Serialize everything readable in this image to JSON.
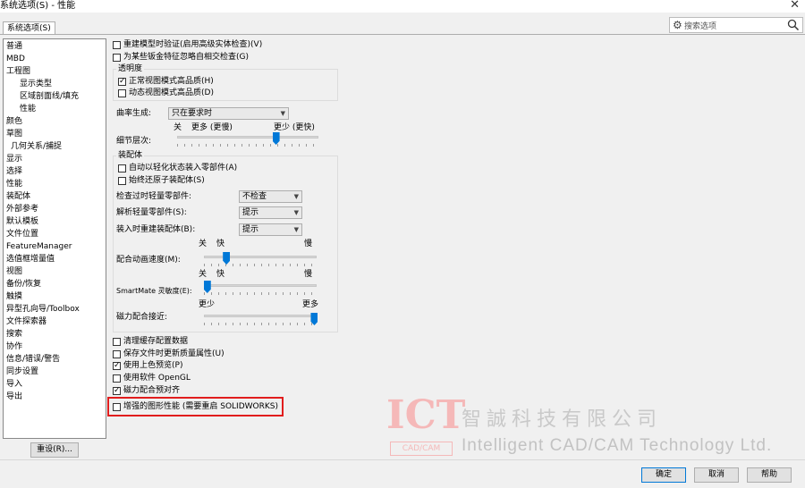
{
  "window": {
    "title": "系统选项(S) - 性能"
  },
  "tab": {
    "label": "系统选项(S)"
  },
  "search": {
    "placeholder": "搜索选项",
    "gear": "gear-icon",
    "mag": "search-icon"
  },
  "nav": {
    "items": [
      {
        "label": "普通",
        "level": 1
      },
      {
        "label": "MBD",
        "level": 1
      },
      {
        "label": "工程图",
        "level": 1
      },
      {
        "label": "显示类型",
        "level": 3
      },
      {
        "label": "区域剖面线/填充",
        "level": 3
      },
      {
        "label": "性能",
        "level": 3
      },
      {
        "label": "颜色",
        "level": 1
      },
      {
        "label": "草图",
        "level": 1
      },
      {
        "label": "几何关系/捕捉",
        "level": 2
      },
      {
        "label": "显示",
        "level": 1
      },
      {
        "label": "选择",
        "level": 1
      },
      {
        "label": "性能",
        "level": 1
      },
      {
        "label": "装配体",
        "level": 1
      },
      {
        "label": "外部参考",
        "level": 1
      },
      {
        "label": "默认模板",
        "level": 1
      },
      {
        "label": "文件位置",
        "level": 1
      },
      {
        "label": "FeatureManager",
        "level": 1
      },
      {
        "label": "选值框增量值",
        "level": 1
      },
      {
        "label": "视图",
        "level": 1
      },
      {
        "label": "备份/恢复",
        "level": 1
      },
      {
        "label": "触摸",
        "level": 1
      },
      {
        "label": "异型孔向导/Toolbox",
        "level": 1
      },
      {
        "label": "文件探索器",
        "level": 1
      },
      {
        "label": "搜索",
        "level": 1
      },
      {
        "label": "协作",
        "level": 1
      },
      {
        "label": "信息/错误/警告",
        "level": 1
      },
      {
        "label": "同步设置",
        "level": 1
      },
      {
        "label": "导入",
        "level": 1
      },
      {
        "label": "导出",
        "level": 1
      }
    ],
    "reset_label": "重设(R)..."
  },
  "options": {
    "rebuild_verify": {
      "label": "重建模型时验证(启用高级实体检查)(V)",
      "checked": false
    },
    "ignore_sheetmetal": {
      "label": "为某些钣金特征忽略自相交检查(G)",
      "checked": false
    },
    "transparency": {
      "title": "透明度",
      "normal_hq": {
        "label": "正常视图模式高品质(H)",
        "checked": true
      },
      "dynamic_hq": {
        "label": "动态视图模式高品质(D)",
        "checked": false
      }
    },
    "curvature": {
      "label": "曲率生成:",
      "value": "只在要求时"
    },
    "lod": {
      "label": "细节层次:",
      "off": "关",
      "more": "更多 (更慢)",
      "less": "更少 (更快)",
      "level": 0.7
    },
    "assembly": {
      "title": "装配体",
      "auto_lightweight": {
        "label": "自动以轻化状态装入零部件(A)",
        "checked": false
      },
      "always_resolve": {
        "label": "始终还原子装配体(S)",
        "checked": false
      },
      "check_outdated": {
        "label": "检查过时轻量零部件:",
        "value": "不检查"
      },
      "resolve_lightweight": {
        "label": "解析轻量零部件(S):",
        "value": "提示"
      },
      "rebuild_on_load": {
        "label": "装入时重建装配体(B):",
        "value": "提示"
      },
      "mate_anim": {
        "label": "配合动画速度(M):",
        "off": "关",
        "fast": "快",
        "slow": "慢",
        "level": 0.2
      },
      "smartmate": {
        "label": "SmartMate 灵敏度(E):",
        "off": "关",
        "fast": "快",
        "slow": "慢",
        "level": 0.03
      },
      "magnetic": {
        "label": "磁力配合接近:",
        "less": "更少",
        "more": "更多",
        "level": 0.98
      }
    },
    "purge_config": {
      "label": "清理缓存配置数据",
      "checked": false
    },
    "update_mass": {
      "label": "保存文件时更新质量属性(U)",
      "checked": false
    },
    "shaded_preview": {
      "label": "使用上色预览(P)",
      "checked": true
    },
    "software_opengl": {
      "label": "使用软件 OpenGL",
      "checked": false
    },
    "magnetic_preview": {
      "label": "磁力配合预对齐",
      "checked": true
    },
    "enhanced_graphics": {
      "label": "增强的图形性能 (需要重启 SOLIDWORKS)",
      "checked": false
    }
  },
  "footer": {
    "ok": "确定",
    "cancel": "取消",
    "help": "帮助"
  },
  "watermark": {
    "logo": "ICT",
    "logo_sub": "CAD/CAM",
    "cn": "智誠科技有限公司",
    "en": "Intelligent CAD/CAM Technology Ltd."
  },
  "colors": {
    "accent": "#0078d7",
    "highlight": "#e11d1d"
  }
}
